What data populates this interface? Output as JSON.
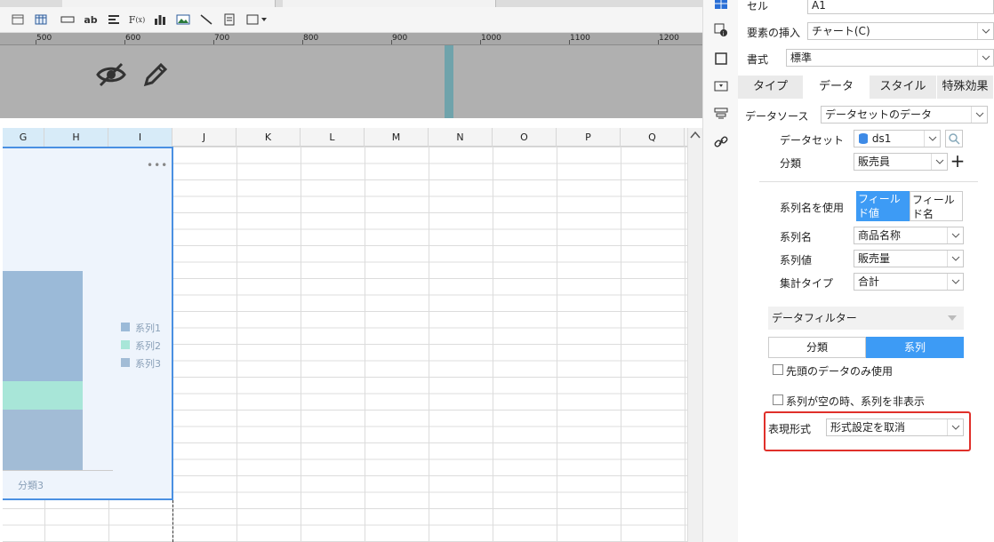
{
  "spreadsheet": {
    "columns": [
      "G",
      "H",
      "I",
      "J",
      "K",
      "L",
      "M",
      "N",
      "O",
      "P",
      "Q"
    ],
    "ruler_labels": [
      "500",
      "600",
      "700",
      "800",
      "900",
      "1000",
      "1100",
      "1200"
    ]
  },
  "chart": {
    "legend": [
      "系列1",
      "系列2",
      "系列3"
    ],
    "category_label": "分類3",
    "colors": [
      "#9bbad8",
      "#a8e6d8",
      "#a2bcd6"
    ]
  },
  "panel": {
    "cell_label": "セル",
    "cell_value": "A1",
    "insert_label": "要素の挿入",
    "insert_value": "チャート(C)",
    "format_label": "書式",
    "format_value": "標準",
    "tabs": [
      "タイプ",
      "データ",
      "スタイル",
      "特殊効果"
    ],
    "datasource_label": "データソース",
    "datasource_value": "データセットのデータ",
    "dataset_label": "データセット",
    "dataset_value": "ds1",
    "category_label": "分類",
    "category_value": "販売員",
    "series_name_use_label": "系列名を使用",
    "toggle_field_value": "フィールド値",
    "toggle_field_name": "フィールド名",
    "series_name_label": "系列名",
    "series_name_value": "商品名称",
    "series_value_label": "系列値",
    "series_value_value": "販売量",
    "agg_label": "集計タイプ",
    "agg_value": "合計",
    "filter_label": "データフィルター",
    "filter_tab_category": "分類",
    "filter_tab_series": "系列",
    "checkbox_first_only": "先頭のデータのみ使用",
    "checkbox_hide_empty": "系列が空の時、系列を非表示",
    "display_format_label": "表現形式",
    "display_format_value": "形式設定を取消",
    "accent_color": "#3d9bf5",
    "highlight_color": "#e0302a"
  }
}
